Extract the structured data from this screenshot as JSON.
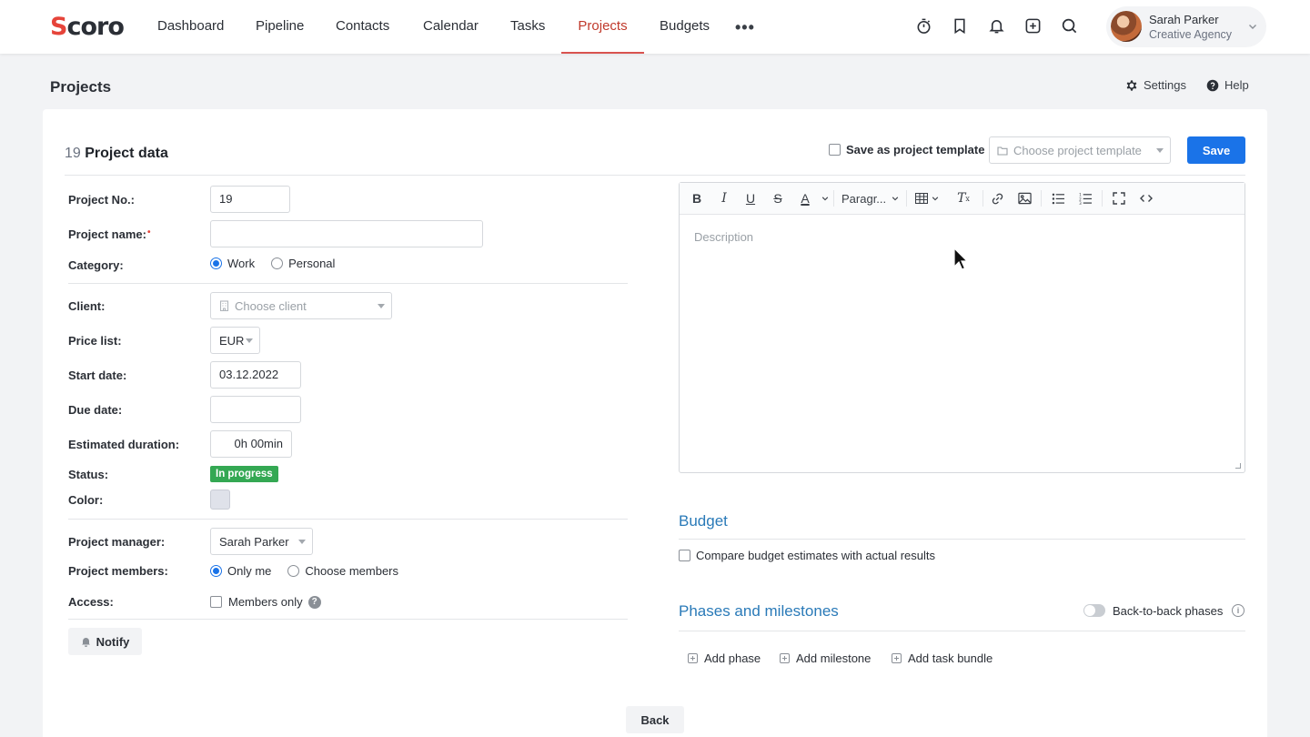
{
  "app": {
    "logo": "coro",
    "logo_initial": "S"
  },
  "nav": {
    "items": [
      "Dashboard",
      "Pipeline",
      "Contacts",
      "Calendar",
      "Tasks",
      "Projects",
      "Budgets"
    ],
    "active": "Projects",
    "more": "•••"
  },
  "icons": [
    "timer-icon",
    "bookmark-icon",
    "bell-icon",
    "add-icon",
    "search-icon"
  ],
  "user": {
    "name": "Sarah Parker",
    "org": "Creative Agency"
  },
  "page": {
    "title": "Projects",
    "settings": "Settings",
    "help": "Help"
  },
  "section": {
    "number": "19",
    "title": "Project data",
    "save_template_label": "Save as project template",
    "template_placeholder": "Choose project template",
    "save_button": "Save"
  },
  "form": {
    "project_no": {
      "label": "Project No.:",
      "value": "19"
    },
    "project_name": {
      "label": "Project name:",
      "value": ""
    },
    "category": {
      "label": "Category:",
      "options": [
        "Work",
        "Personal"
      ],
      "selected": "Work"
    },
    "client": {
      "label": "Client:",
      "placeholder": "Choose client"
    },
    "price_list": {
      "label": "Price list:",
      "value": "EUR"
    },
    "start_date": {
      "label": "Start date:",
      "value": "03.12.2022"
    },
    "due_date": {
      "label": "Due date:",
      "value": ""
    },
    "estimated_duration": {
      "label": "Estimated duration:",
      "value": "0h 00min"
    },
    "status": {
      "label": "Status:",
      "value": "In progress",
      "color": "#34a853"
    },
    "color": {
      "label": "Color:",
      "value": "#dfe2ea"
    },
    "project_manager": {
      "label": "Project manager:",
      "value": "Sarah Parker"
    },
    "project_members": {
      "label": "Project members:",
      "options": [
        "Only me",
        "Choose members"
      ],
      "selected": "Only me"
    },
    "access": {
      "label": "Access:",
      "option": "Members only"
    },
    "notify_button": "Notify"
  },
  "editor": {
    "paragraph_label": "Paragr...",
    "placeholder": "Description"
  },
  "budget": {
    "title": "Budget",
    "compare_label": "Compare budget estimates with actual results"
  },
  "phases": {
    "title": "Phases and milestones",
    "toggle_label": "Back-to-back phases",
    "actions": [
      "Add phase",
      "Add milestone",
      "Add task bundle"
    ]
  },
  "back_button": "Back",
  "colors": {
    "accent": "#1a73e8",
    "brand": "#e6443a",
    "section_title": "#2a7ab8"
  }
}
